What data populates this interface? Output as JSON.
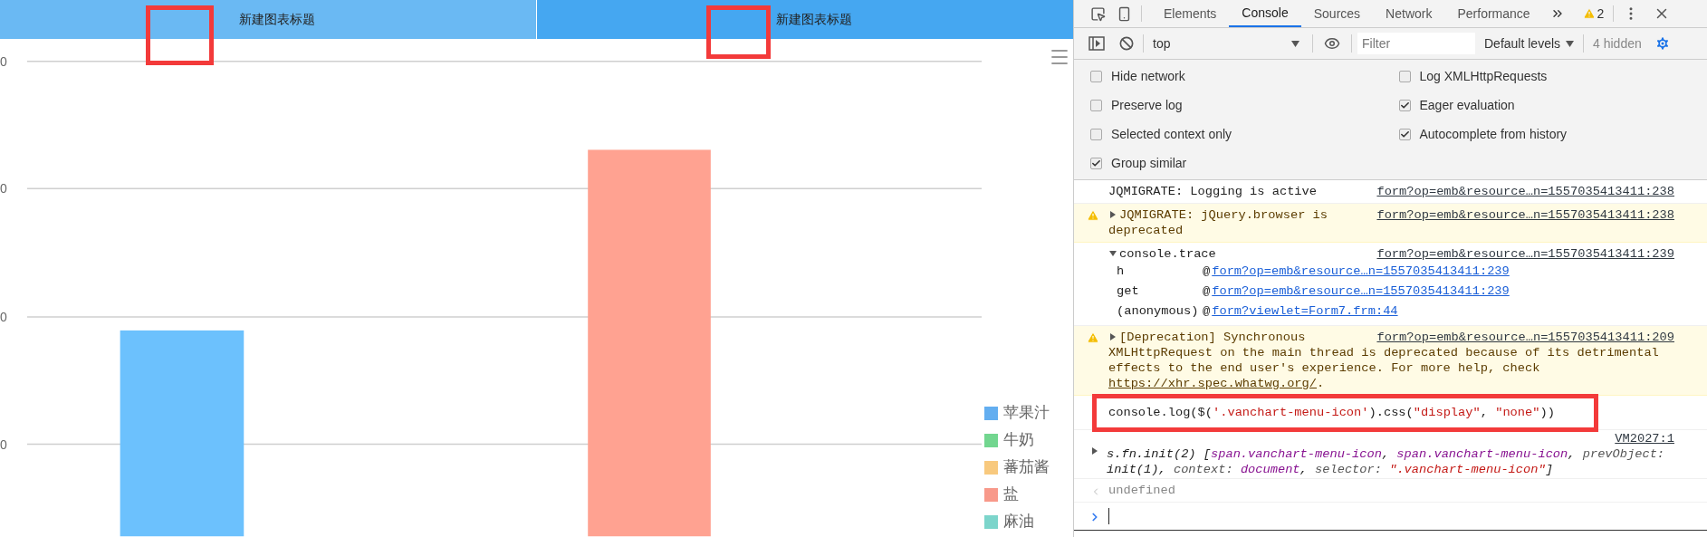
{
  "chart": {
    "title_bars": [
      {
        "text": "新建图表标题",
        "color": "#6ab9f3"
      },
      {
        "text": "新建图表标题",
        "color": "#45a7f1"
      }
    ],
    "axis_labels": [
      "0",
      "0",
      "0",
      "0"
    ],
    "legend": [
      {
        "label": "苹果汁",
        "color": "#63aef0"
      },
      {
        "label": "牛奶",
        "color": "#72d68f"
      },
      {
        "label": "蕃茄酱",
        "color": "#f8c97e"
      },
      {
        "label": "盐",
        "color": "#f8998a"
      },
      {
        "label": "麻油",
        "color": "#7cd5cb"
      }
    ]
  },
  "devtools": {
    "tabs": [
      {
        "label": "Elements",
        "selected": false
      },
      {
        "label": "Console",
        "selected": true
      },
      {
        "label": "Sources",
        "selected": false
      },
      {
        "label": "Network",
        "selected": false
      },
      {
        "label": "Performance",
        "selected": false
      }
    ],
    "warning_count": "2",
    "toolbar": {
      "context": "top",
      "filter_placeholder": "Filter",
      "levels": "Default levels",
      "hidden": "4 hidden"
    },
    "settings": [
      {
        "label": "Hide network",
        "checked": false
      },
      {
        "label": "Log XMLHttpRequests",
        "checked": false
      },
      {
        "label": "Preserve log",
        "checked": false
      },
      {
        "label": "Eager evaluation",
        "checked": true
      },
      {
        "label": "Selected context only",
        "checked": false
      },
      {
        "label": "Autocomplete from history",
        "checked": true
      },
      {
        "label": "Group similar",
        "checked": true
      }
    ],
    "messages": [
      {
        "kind": "log",
        "text": "JQMIGRATE: Logging is active",
        "source": "form?op=emb&resource…n=1557035413411:238"
      },
      {
        "kind": "warning",
        "expanded": false,
        "text": "JQMIGRATE: jQuery.browser is deprecated",
        "source": "form?op=emb&resource…n=1557035413411:238"
      },
      {
        "kind": "trace",
        "expanded": true,
        "text": "console.trace",
        "source": "form?op=emb&resource…n=1557035413411:239",
        "frames": [
          {
            "function": "h",
            "at": "@",
            "link": "form?op=emb&resource…n=1557035413411:239"
          },
          {
            "function": "get",
            "at": "@",
            "link": "form?op=emb&resource…n=1557035413411:239"
          },
          {
            "function": "(anonymous)",
            "at": "@",
            "link": "form?viewlet=Form7.frm:44"
          }
        ]
      },
      {
        "kind": "warning",
        "expanded": false,
        "text": "[Deprecation] Synchronous",
        "continuation": "XMLHttpRequest on the main thread is deprecated because of its detrimental effects to the end user's experience. For more help, check ",
        "link": "https://xhr.spec.whatwg.org/",
        "after": ".",
        "source": "form?op=emb&resource…n=1557035413411:209"
      },
      {
        "kind": "command",
        "tokens": [
          {
            "text": "console.log($(",
            "kind": "plain"
          },
          {
            "text": "'.vanchart-menu-icon'",
            "kind": "string"
          },
          {
            "text": ").css(",
            "kind": "plain"
          },
          {
            "text": "\"display\"",
            "kind": "string"
          },
          {
            "text": ", ",
            "kind": "plain"
          },
          {
            "text": "\"none\"",
            "kind": "string"
          },
          {
            "text": "))",
            "kind": "plain"
          }
        ]
      },
      {
        "kind": "result",
        "expanded": false,
        "source": "VM2027:1",
        "tokens": [
          {
            "text": "s.fn.init(2) [",
            "kind": "plain"
          },
          {
            "text": "span.vanchart-menu-icon",
            "kind": "node"
          },
          {
            "text": ", ",
            "kind": "plain"
          },
          {
            "text": "span.vanchart-menu-icon",
            "kind": "node"
          },
          {
            "text": ", ",
            "kind": "plain"
          },
          {
            "text": "prevObject:",
            "kind": "key"
          },
          {
            "text": " init(1), ",
            "kind": "plain"
          },
          {
            "text": "context: ",
            "kind": "key"
          },
          {
            "text": "document",
            "kind": "node"
          },
          {
            "text": ", ",
            "kind": "plain"
          },
          {
            "text": "selector: ",
            "kind": "key"
          },
          {
            "text": "\".vanchart-menu-icon\"",
            "kind": "string"
          },
          {
            "text": "]",
            "kind": "plain"
          }
        ]
      },
      {
        "kind": "return",
        "text": "undefined"
      },
      {
        "kind": "prompt"
      }
    ]
  }
}
